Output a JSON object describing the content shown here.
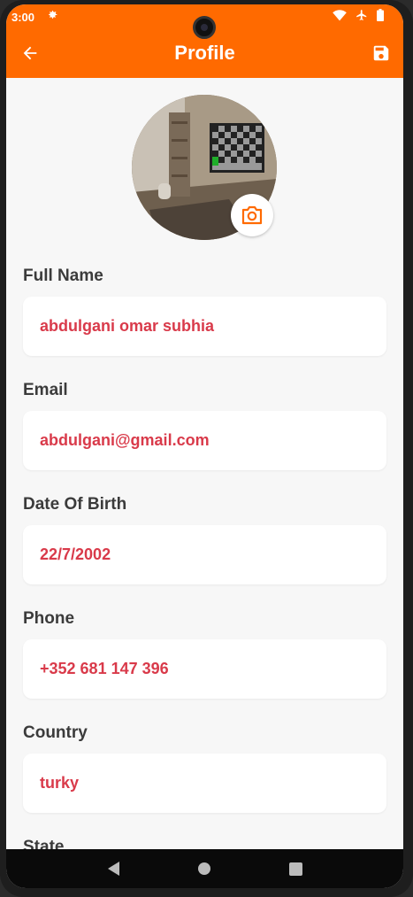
{
  "status_bar": {
    "time": "3:00",
    "gear_icon": "gear-icon",
    "wifi_icon": "wifi-icon",
    "airplane_icon": "airplane-icon",
    "battery_icon": "battery-icon"
  },
  "app_bar": {
    "title": "Profile",
    "back_icon": "arrow-left-icon",
    "save_icon": "save-icon",
    "color": "#ff6a00"
  },
  "avatar": {
    "camera_icon": "camera-icon"
  },
  "fields": [
    {
      "label": "Full Name",
      "value": "abdulgani omar subhia"
    },
    {
      "label": "Email",
      "value": "abdulgani@gmail.com"
    },
    {
      "label": "Date Of Birth",
      "value": "22/7/2002"
    },
    {
      "label": "Phone",
      "value": "+352 681 147 396"
    },
    {
      "label": "Country",
      "value": "turky"
    },
    {
      "label": "State",
      "value": ""
    }
  ],
  "colors": {
    "accent": "#ff6a00",
    "value_text": "#d93a4a",
    "label_text": "#3b3b3b",
    "background": "#f7f7f7"
  }
}
